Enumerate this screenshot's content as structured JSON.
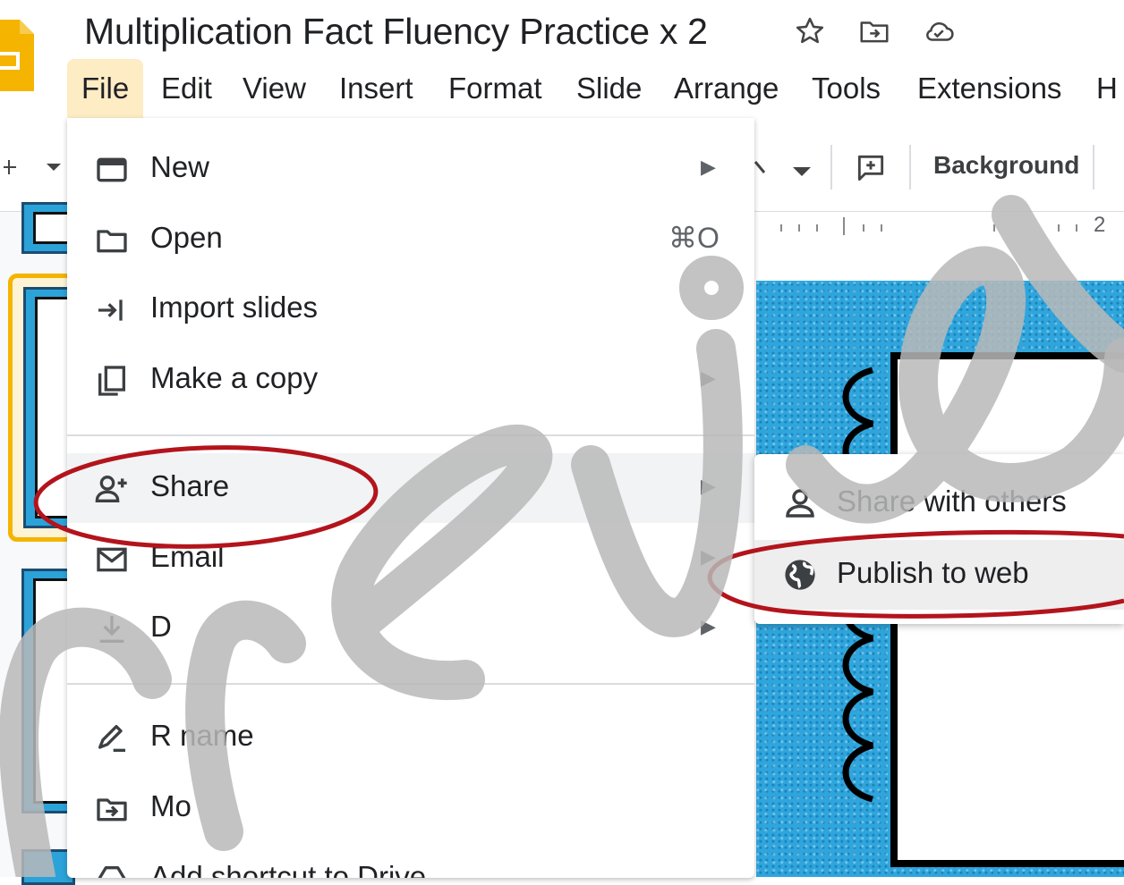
{
  "document": {
    "title": "Multiplication Fact Fluency Practice x 2"
  },
  "title_icons": [
    "star-icon",
    "move-to-folder-icon",
    "cloud-saved-icon"
  ],
  "menubar": {
    "items": [
      {
        "label": "File",
        "active": true
      },
      {
        "label": "Edit"
      },
      {
        "label": "View"
      },
      {
        "label": "Insert"
      },
      {
        "label": "Format"
      },
      {
        "label": "Slide"
      },
      {
        "label": "Arrange"
      },
      {
        "label": "Tools"
      },
      {
        "label": "Extensions"
      },
      {
        "label": "H"
      }
    ]
  },
  "toolbar": {
    "background_button": "Background",
    "ruler_number": "2"
  },
  "file_menu": {
    "items": [
      {
        "label": "New",
        "icon": "new-presentation-icon",
        "submenu": true
      },
      {
        "label": "Open",
        "icon": "folder-icon",
        "shortcut": "⌘O"
      },
      {
        "label": "Import slides",
        "icon": "import-icon"
      },
      {
        "label": "Make a copy",
        "icon": "copy-icon",
        "submenu": true
      },
      {
        "label": "Share",
        "icon": "add-person-icon",
        "submenu": true,
        "highlighted": true
      },
      {
        "label": "Email",
        "icon": "email-icon",
        "submenu": true
      },
      {
        "label": "D      ",
        "icon": "download-icon",
        "submenu": true
      },
      {
        "label": "R  name",
        "icon": "rename-icon"
      },
      {
        "label": "Mo",
        "icon": "move-icon"
      },
      {
        "label": "Add shortcut to Drive",
        "icon": "drive-shortcut-icon"
      }
    ]
  },
  "share_submenu": {
    "items": [
      {
        "label": "Share with others",
        "icon": "person-icon"
      },
      {
        "label": "Publish to web",
        "icon": "globe-icon",
        "highlighted": true
      }
    ]
  },
  "annotation_color": "#b3141c",
  "accent_colors": {
    "menu_active": "#fdecc4",
    "slide_blue": "#2ea6dd",
    "selected_thumb": "#f4b400"
  },
  "watermark": {
    "text": "preview",
    "color": "#b8b8b8"
  }
}
